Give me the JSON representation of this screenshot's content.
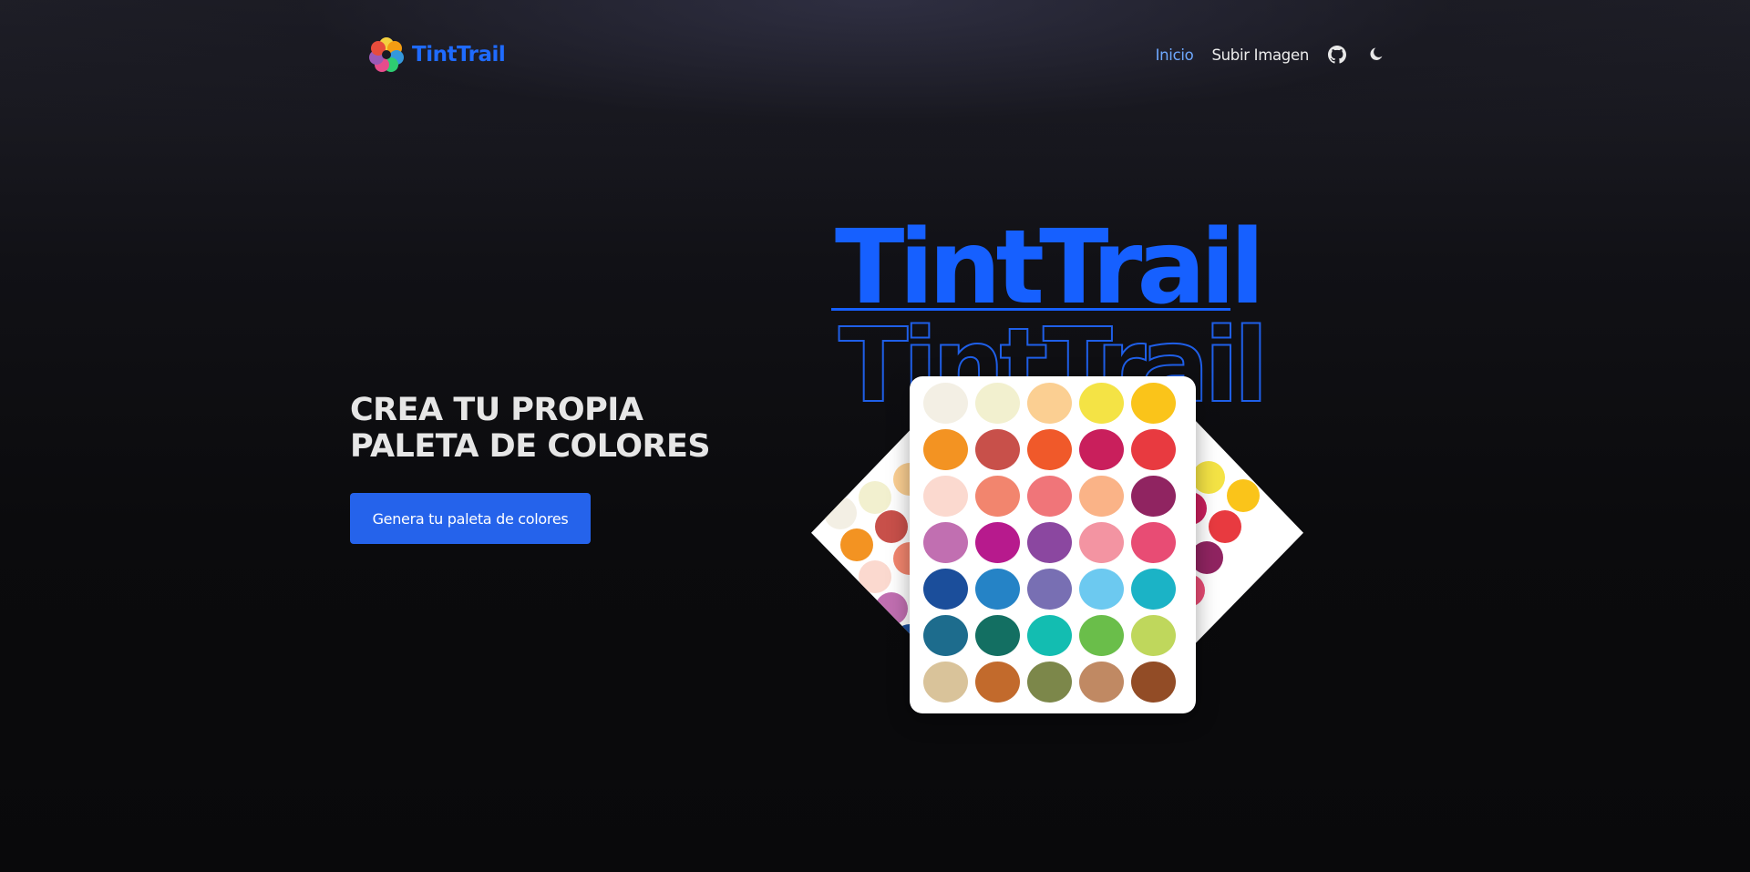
{
  "brand": {
    "name": "TintTrail",
    "logo_icon": "flower-palette-logo",
    "accent_color": "#1f6bff"
  },
  "nav": {
    "links": [
      {
        "label": "Inicio",
        "active": true,
        "color": "#6ea8fe"
      },
      {
        "label": "Subir Imagen",
        "active": false,
        "color": "#ececec"
      }
    ],
    "icons": [
      "github-icon",
      "moon-icon"
    ]
  },
  "hero": {
    "title_line1": "CREA TU PROPIA",
    "title_line2": "PALETA DE COLORES",
    "cta_label": "Genera tu paleta de colores",
    "cta_color": "#2563eb"
  },
  "art": {
    "big_title": "TintTrail",
    "outline_title": "TintTrail",
    "palette_colors": [
      [
        "#f3efe4",
        "#f2f0cf",
        "#fbcf92",
        "#f4e345",
        "#fac41a"
      ],
      [
        "#f39322",
        "#c8504a",
        "#f0592a",
        "#c91f5c",
        "#e83a40"
      ],
      [
        "#fbd9cf",
        "#f2856e",
        "#f07579",
        "#fab387",
        "#902461"
      ],
      [
        "#c16fb1",
        "#b71a8d",
        "#8b47a0",
        "#f394a2",
        "#e84c74"
      ],
      [
        "#1b4e9b",
        "#2583c6",
        "#786fb3",
        "#6cc9f0",
        "#1bb3c6"
      ],
      [
        "#1d6c8d",
        "#136f62",
        "#13bdb1",
        "#6abe4a",
        "#bfd75c"
      ],
      [
        "#d9c39a",
        "#c26a2c",
        "#7c874a",
        "#c08963",
        "#924c26"
      ]
    ]
  }
}
